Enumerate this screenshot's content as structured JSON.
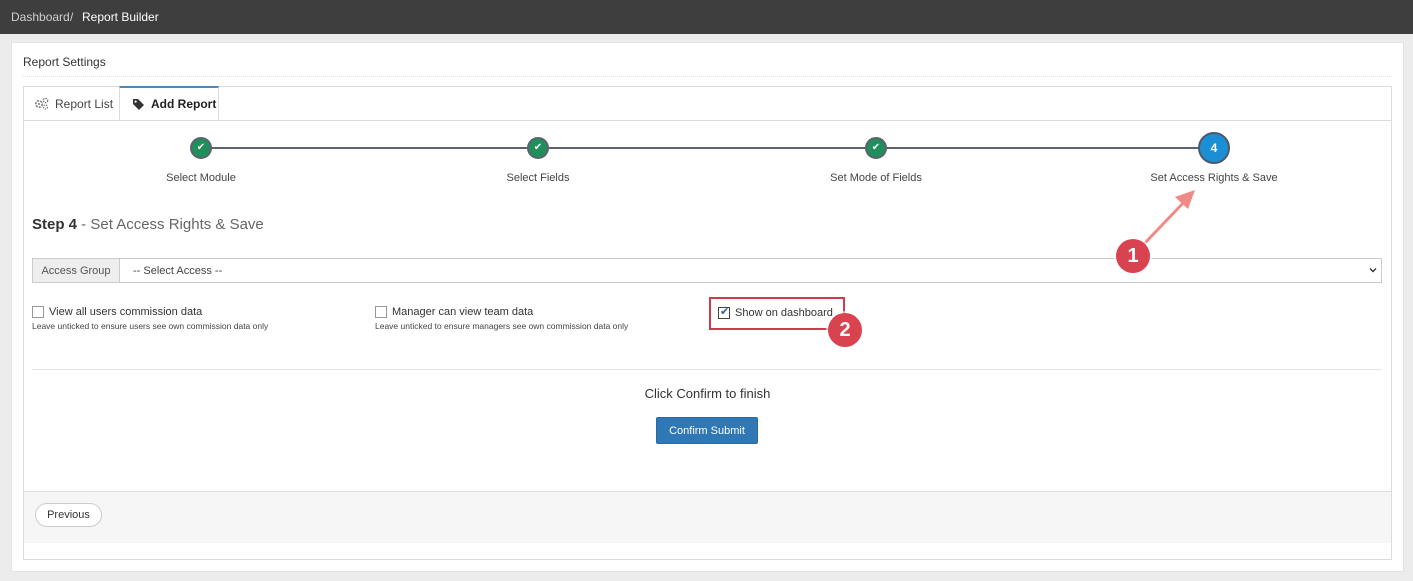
{
  "breadcrumb": {
    "parent": "Dashboard",
    "separator": "/",
    "current": "Report Builder"
  },
  "panel": {
    "title": "Report Settings"
  },
  "tabs": [
    {
      "label": "Report List",
      "icon": "gears-icon",
      "active": false
    },
    {
      "label": "Add Report",
      "icon": "tag-icon",
      "active": true
    }
  ],
  "wizard": {
    "steps": [
      {
        "label": "Select Module",
        "state": "done"
      },
      {
        "label": "Select Fields",
        "state": "done"
      },
      {
        "label": "Set Mode of Fields",
        "state": "done"
      },
      {
        "label": "Set Access Rights & Save",
        "state": "active",
        "number": "4"
      }
    ]
  },
  "step": {
    "prefix": "Step 4",
    "dash": " - ",
    "title": "Set Access Rights & Save"
  },
  "access": {
    "label": "Access Group",
    "selected": "-- Select Access --"
  },
  "options": {
    "view_all": {
      "label": "View all users commission data",
      "help": "Leave unticked to ensure users see own commission data only",
      "checked": false
    },
    "manager_view": {
      "label": "Manager can view team data",
      "help": "Leave unticked to ensure managers see own commission data only",
      "checked": false
    },
    "show_dashboard": {
      "label": "Show on dashboard",
      "checked": true
    }
  },
  "confirm": {
    "text": "Click Confirm to finish",
    "button": "Confirm Submit"
  },
  "footer": {
    "previous": "Previous"
  },
  "annotations": {
    "badge_1": "1",
    "badge_2": "2"
  },
  "colors": {
    "topbar": "#3e3e3e",
    "done_step": "#1f8f5b",
    "active_step": "#1b8fd6",
    "primary_button": "#2f77b5",
    "annotation_red": "#d9434f",
    "annotation_arrow": "#f08a85"
  }
}
